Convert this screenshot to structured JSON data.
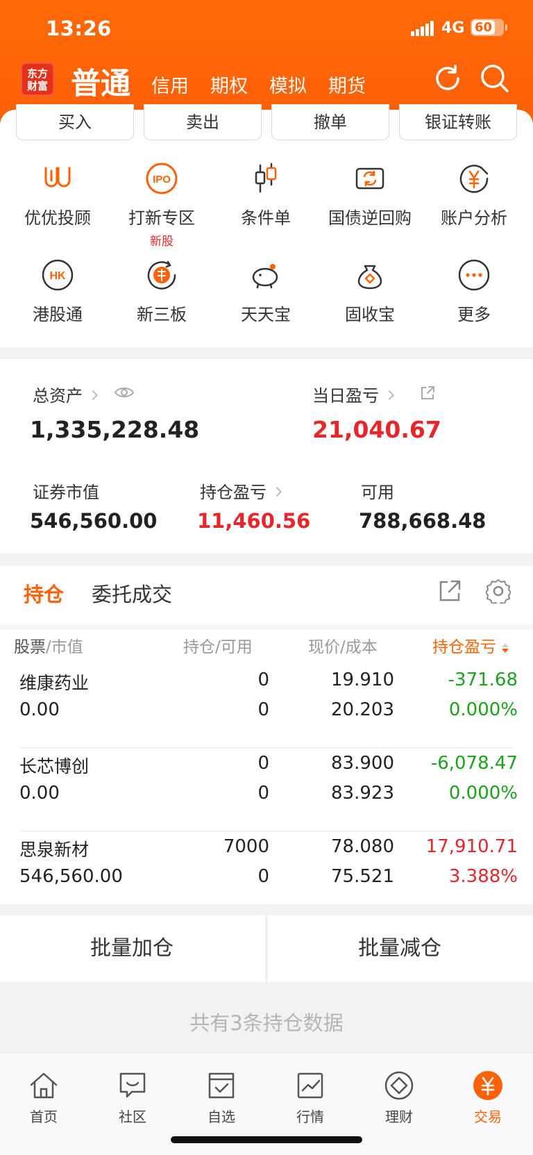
{
  "status_bar": {
    "time": "13:26",
    "network": "4G",
    "battery": "60"
  },
  "header": {
    "logo_line1": "东方",
    "logo_line2": "财富",
    "active_tab": "普通",
    "tabs": [
      "信用",
      "期权",
      "模拟",
      "期货"
    ],
    "icons": [
      "refresh-icon",
      "search-icon"
    ]
  },
  "quick_actions": [
    "买入",
    "卖出",
    "撤单",
    "银证转账"
  ],
  "grid": [
    {
      "label": "优优投顾",
      "icon": "youyou-icon"
    },
    {
      "label": "打新专区",
      "icon": "ipo-icon",
      "badge": "新股"
    },
    {
      "label": "条件单",
      "icon": "candlestick-icon"
    },
    {
      "label": "国债逆回购",
      "icon": "repo-icon"
    },
    {
      "label": "账户分析",
      "icon": "yen-chart-icon"
    },
    {
      "label": "港股通",
      "icon": "hk-icon"
    },
    {
      "label": "新三板",
      "icon": "xin-icon"
    },
    {
      "label": "天天宝",
      "icon": "piggy-bank-icon"
    },
    {
      "label": "固收宝",
      "icon": "money-bag-icon"
    },
    {
      "label": "更多",
      "icon": "more-icon"
    }
  ],
  "assets": {
    "total_label": "总资产",
    "total_value": "1,335,228.48",
    "daily_pl_label": "当日盈亏",
    "daily_pl_value": "21,040.67",
    "market_value_label": "证券市值",
    "market_value": "546,560.00",
    "position_pl_label": "持仓盈亏",
    "position_pl_value": "11,460.56",
    "available_label": "可用",
    "available_value": "788,668.48"
  },
  "holdings": {
    "active_tab": "持仓",
    "tab2": "委托成交",
    "headers": {
      "col1_a": "股票",
      "col1_b": "/市值",
      "col2": "持仓/可用",
      "col3": "现价/成本",
      "col4": "持仓盈亏"
    },
    "rows": [
      {
        "name": "维康药业",
        "market_value": "0.00",
        "position": "0",
        "available": "0",
        "price": "19.910",
        "cost": "20.203",
        "pl": "-371.68",
        "pl_pct": "0.000%",
        "color": "green"
      },
      {
        "name": "长芯博创",
        "market_value": "0.00",
        "position": "0",
        "available": "0",
        "price": "83.900",
        "cost": "83.923",
        "pl": "-6,078.47",
        "pl_pct": "0.000%",
        "color": "green"
      },
      {
        "name": "思泉新材",
        "market_value": "546,560.00",
        "position": "7000",
        "available": "0",
        "price": "78.080",
        "cost": "75.521",
        "pl": "17,910.71",
        "pl_pct": "3.388%",
        "color": "red"
      }
    ]
  },
  "batch": {
    "add": "批量加仓",
    "reduce": "批量减仓"
  },
  "count_text": "共有3条持仓数据",
  "bottom_nav": [
    {
      "label": "首页",
      "icon": "home-icon"
    },
    {
      "label": "社区",
      "icon": "community-icon"
    },
    {
      "label": "自选",
      "icon": "watchlist-icon"
    },
    {
      "label": "行情",
      "icon": "market-chart-icon"
    },
    {
      "label": "理财",
      "icon": "wealth-icon"
    },
    {
      "label": "交易",
      "icon": "trade-yen-icon",
      "active": true
    }
  ],
  "colors": {
    "brand": "#ff6205",
    "up": "#e5262b",
    "down": "#1ea11e"
  }
}
